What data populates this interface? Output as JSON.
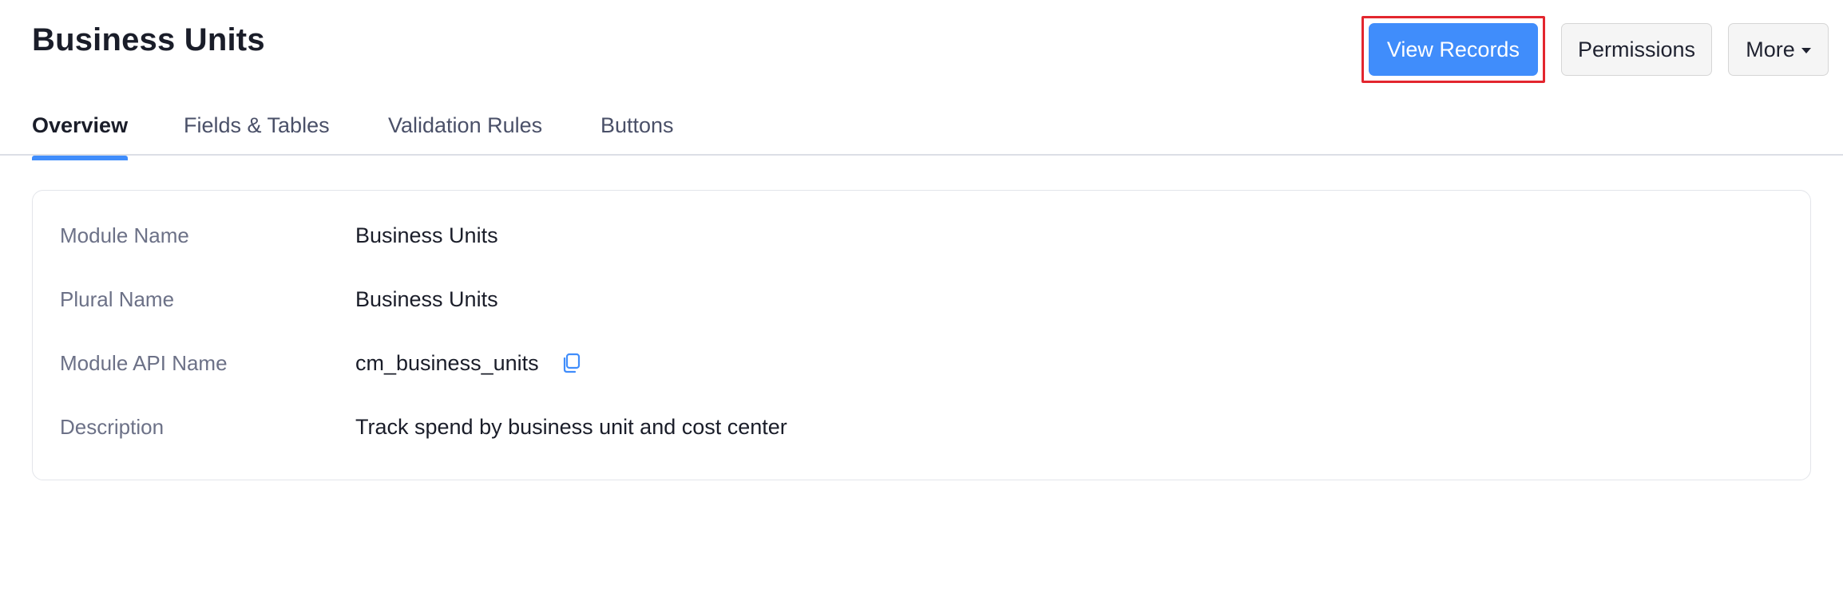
{
  "header": {
    "title": "Business Units",
    "actions": {
      "view_records_label": "View Records",
      "permissions_label": "Permissions",
      "more_label": "More"
    }
  },
  "tabs": [
    {
      "label": "Overview",
      "active": true
    },
    {
      "label": "Fields & Tables",
      "active": false
    },
    {
      "label": "Validation Rules",
      "active": false
    },
    {
      "label": "Buttons",
      "active": false
    }
  ],
  "details": {
    "rows": [
      {
        "label": "Module Name",
        "value": "Business Units"
      },
      {
        "label": "Plural Name",
        "value": "Business Units"
      },
      {
        "label": "Module API Name",
        "value": "cm_business_units",
        "icon": "copy-icon"
      },
      {
        "label": "Description",
        "value": "Track spend by business unit and cost center"
      }
    ]
  },
  "colors": {
    "primary": "#408dfb",
    "highlight": "#e3262e",
    "label": "#6c7187"
  }
}
